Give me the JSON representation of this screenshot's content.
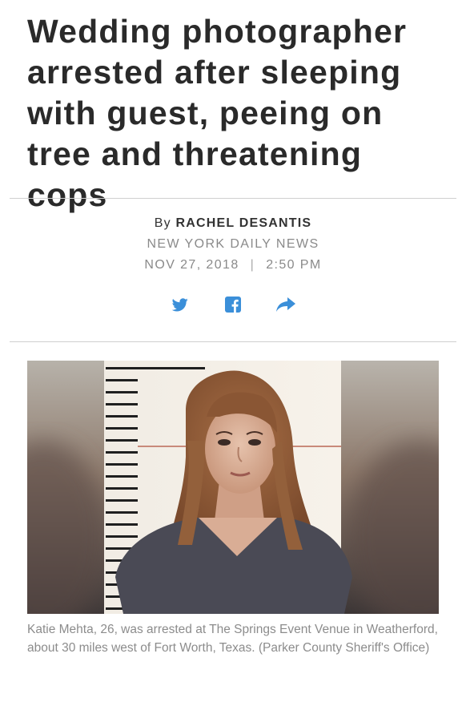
{
  "article": {
    "headline": "Wedding photographer arrested after sleeping with guest, peeing on tree and threatening cops",
    "byline_prefix": "By",
    "author": "RACHEL DESANTIS",
    "source": "NEW YORK DAILY NEWS",
    "date": "NOV 27, 2018",
    "date_separator": "|",
    "time": "2:50 PM"
  },
  "share": {
    "icons": [
      "twitter-icon",
      "facebook-icon",
      "share-arrow-icon"
    ],
    "color": "#3b8fd9"
  },
  "photo": {
    "caption": "Katie Mehta, 26, was arrested at The Springs Event Venue in Weatherford, about 30 miles west of Fort Worth, Texas. (Parker County Sheriff's Office)"
  }
}
